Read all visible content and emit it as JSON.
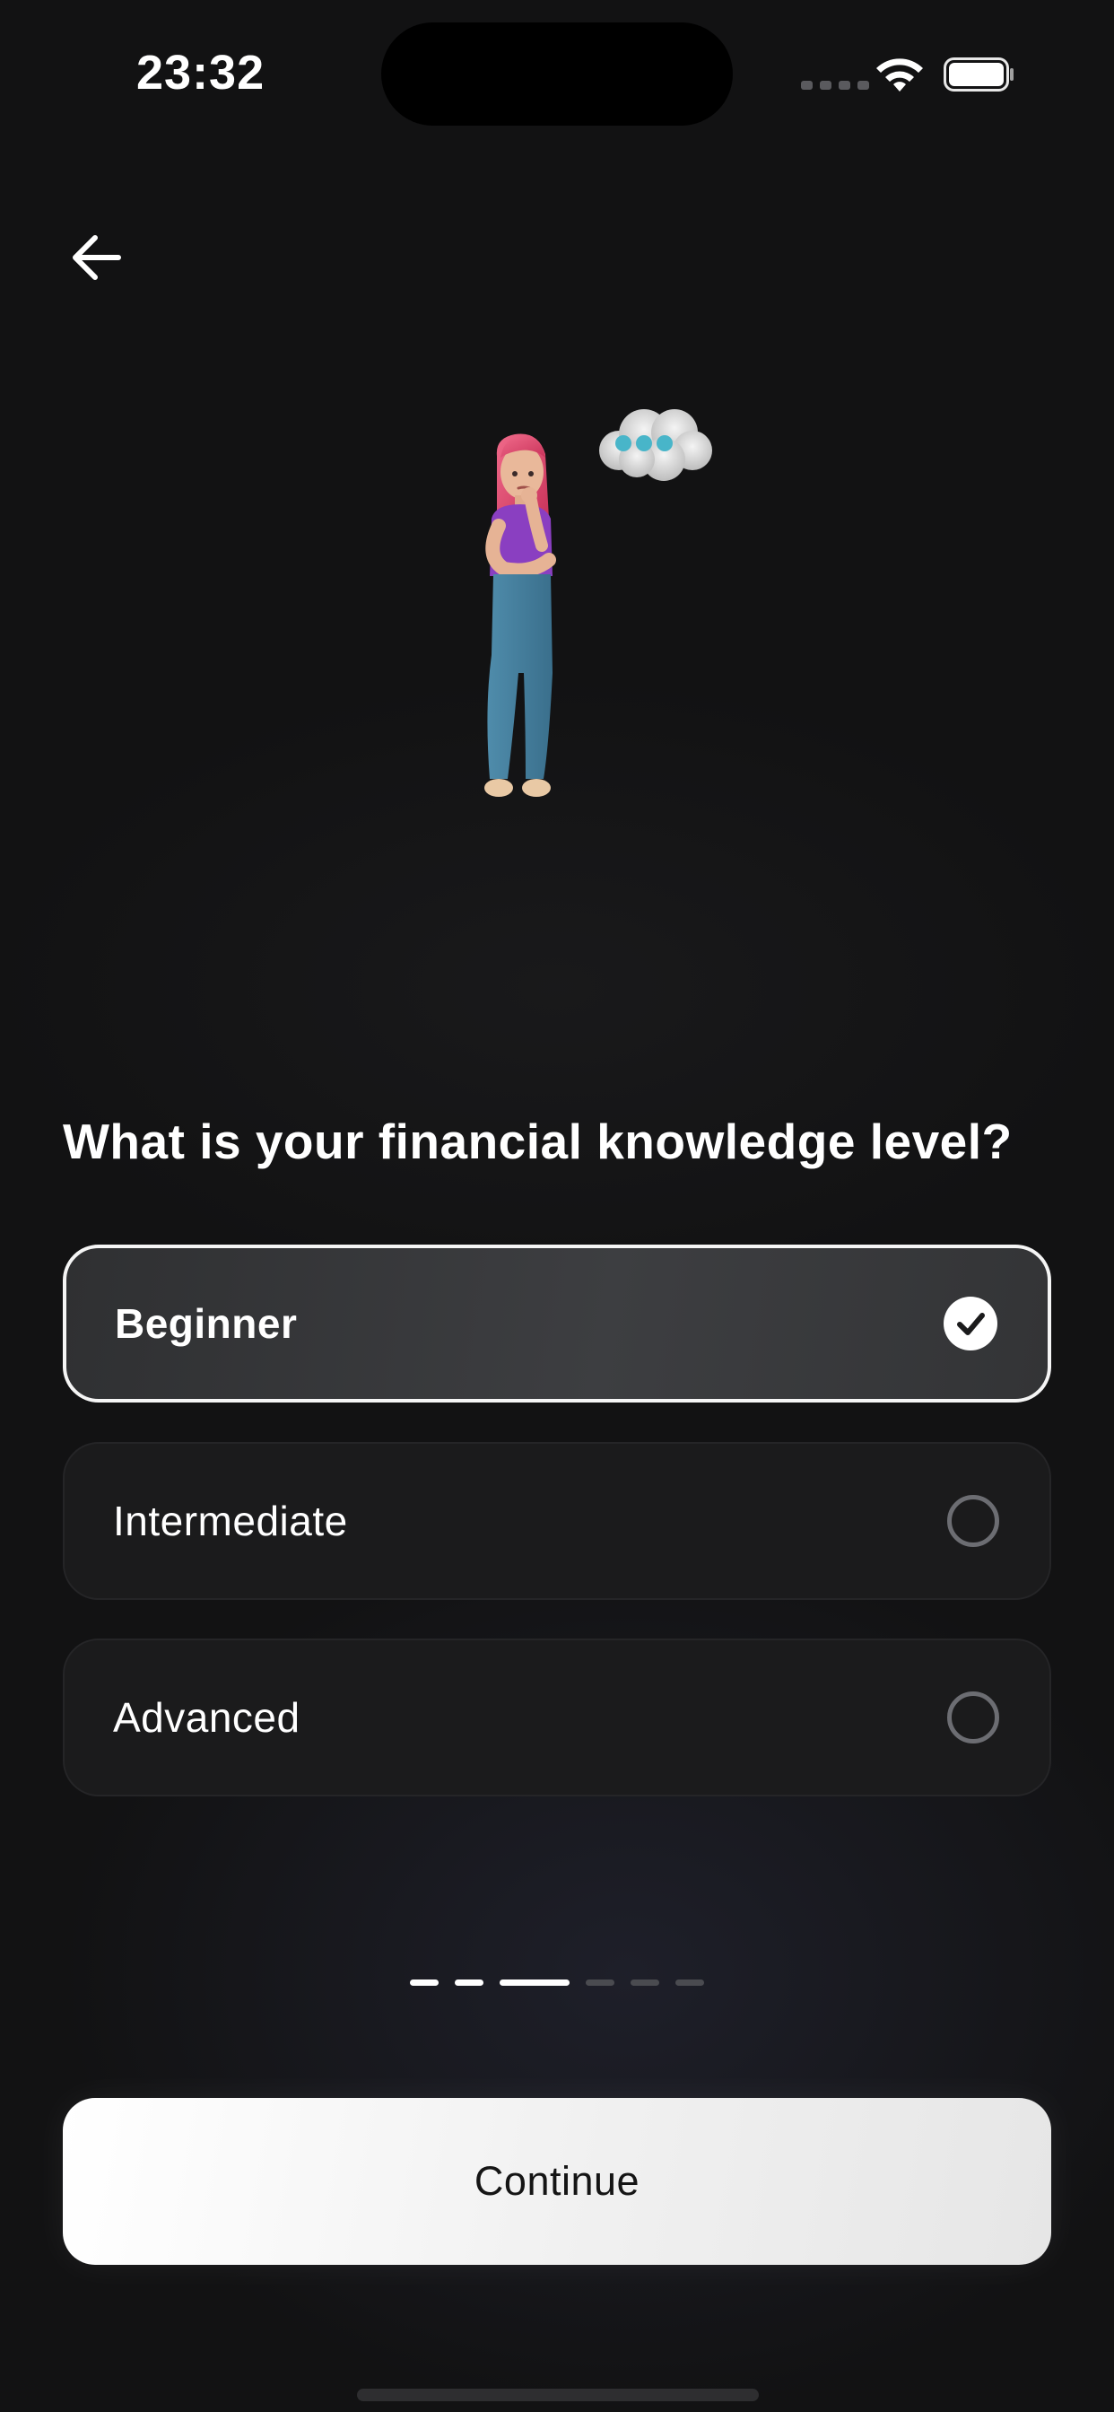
{
  "status_bar": {
    "time": "23:32",
    "signal_icon": "cellular-signal-icon",
    "wifi_icon": "wifi-icon",
    "battery_icon": "battery-icon"
  },
  "header": {
    "back_icon": "arrow-left-icon"
  },
  "illustration": {
    "name": "thinking-woman-illustration"
  },
  "question": "What is your financial knowledge level?",
  "options": [
    {
      "label": "Beginner",
      "selected": true
    },
    {
      "label": "Intermediate",
      "selected": false
    },
    {
      "label": "Advanced",
      "selected": false
    }
  ],
  "progress": {
    "total_steps": 6,
    "current_step": 3
  },
  "continue_label": "Continue",
  "colors": {
    "background": "#121213",
    "option_background": "#1b1b1c",
    "selected_border": "#f5f5f5",
    "button_background": "#ffffff",
    "inactive_progress": "#4a4b50"
  }
}
